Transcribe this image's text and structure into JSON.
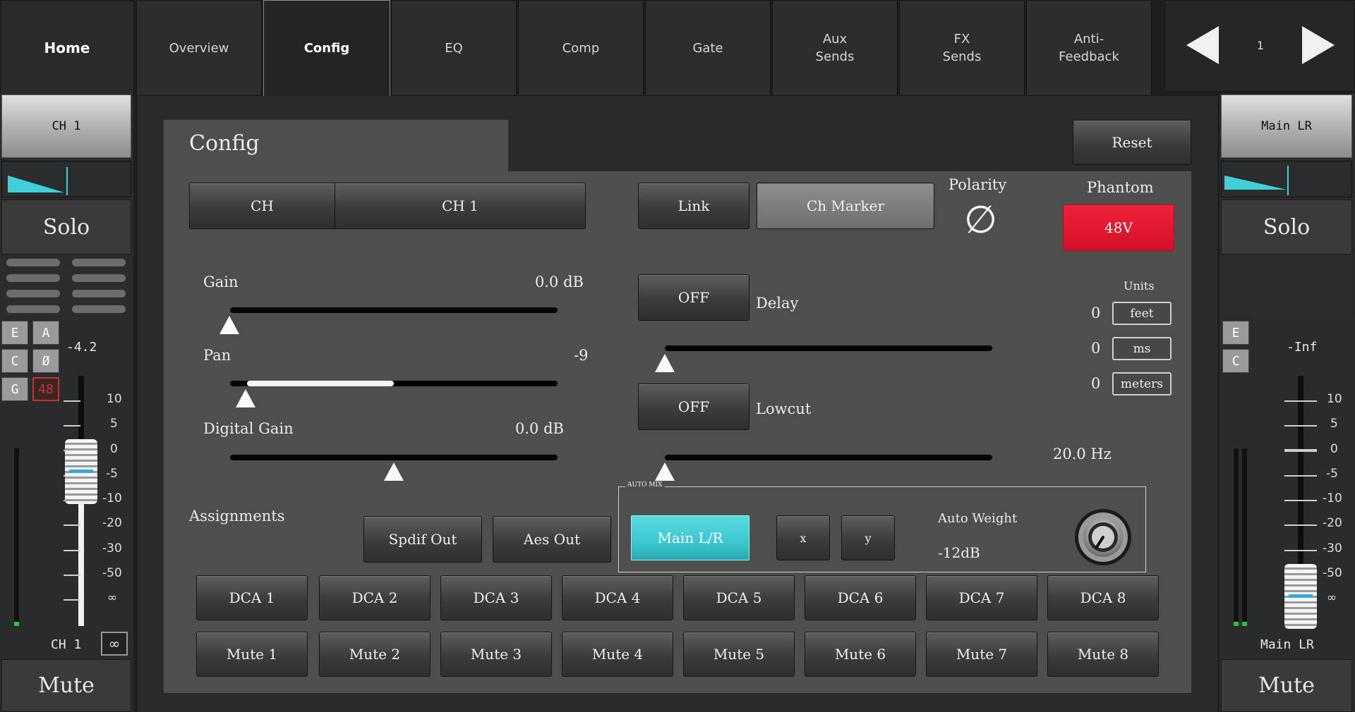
{
  "tabs": {
    "home": "Home",
    "overview": "Overview",
    "config": "Config",
    "eq": "EQ",
    "comp": "Comp",
    "gate": "Gate",
    "aux_sends": "Aux\nSends",
    "fx_sends": "FX\nSends",
    "anti_feedback": "Anti-\nFeedback"
  },
  "pager": {
    "page": "1"
  },
  "left_strip": {
    "channel_button": "CH 1",
    "solo": "Solo",
    "e": "E",
    "a": "A",
    "c": "C",
    "phase": "Ø",
    "g": "G",
    "phantom": "48",
    "level": "-4.2",
    "scale": [
      "10",
      "5",
      "0",
      "-5",
      "-10",
      "-20",
      "-30",
      "-50",
      "∞"
    ],
    "name": "CH 1",
    "link": "∞",
    "mute": "Mute"
  },
  "right_strip": {
    "channel_button": "Main LR",
    "solo": "Solo",
    "e": "E",
    "c": "C",
    "level": "-Inf",
    "scale": [
      "10",
      "5",
      "0",
      "-5",
      "-10",
      "-20",
      "-30",
      "-50",
      "∞"
    ],
    "name": "Main LR",
    "mute": "Mute"
  },
  "config": {
    "title": "Config",
    "reset": "Reset",
    "ch_label": "CH",
    "ch_value": "CH 1",
    "link": "Link",
    "ch_marker": "Ch Marker",
    "polarity": "Polarity",
    "polarity_symbol": "∅",
    "phantom_label": "Phantom",
    "phantom_btn": "48V",
    "phantom_color": "#f0213a",
    "accent_color": "#3cc8d0",
    "gain_label": "Gain",
    "gain_value": "0.0 dB",
    "gain_level": 0,
    "pan_label": "Pan",
    "pan_value": "-9",
    "digital_gain_label": "Digital Gain",
    "digital_gain_value": "0.0 dB",
    "delay_btn": "OFF",
    "delay_label": "Delay",
    "units_label": "Units",
    "unit_feet_value": "0",
    "unit_feet": "feet",
    "unit_ms_value": "0",
    "unit_ms": "ms",
    "unit_meters_value": "0",
    "unit_meters": "meters",
    "lowcut_btn": "OFF",
    "lowcut_label": "Lowcut",
    "lowcut_value": "20.0 Hz",
    "assignments_label": "Assignments",
    "spdif_out": "Spdif Out",
    "aes_out": "Aes Out",
    "auto_mix_legend": "AUTO MIX",
    "main_lr": "Main L/R",
    "x_btn": "x",
    "y_btn": "y",
    "auto_weight_label": "Auto Weight",
    "auto_weight_value": "-12dB",
    "dca": [
      "DCA 1",
      "DCA 2",
      "DCA 3",
      "DCA 4",
      "DCA 5",
      "DCA 6",
      "DCA 7",
      "DCA 8"
    ],
    "mutes": [
      "Mute 1",
      "Mute 2",
      "Mute 3",
      "Mute 4",
      "Mute 5",
      "Mute 6",
      "Mute 7",
      "Mute 8"
    ]
  }
}
